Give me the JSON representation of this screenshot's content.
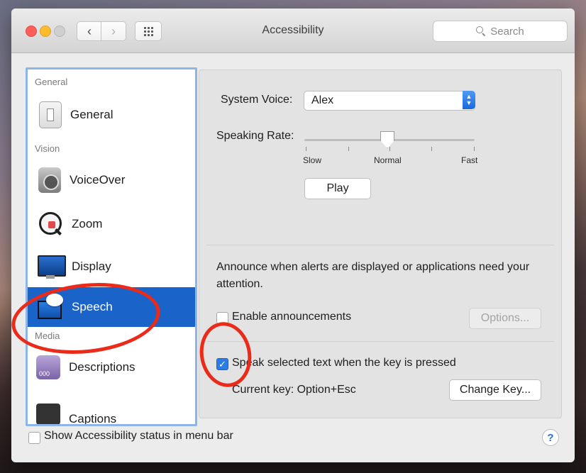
{
  "window": {
    "title": "Accessibility",
    "search_placeholder": "Search"
  },
  "nav": {
    "back_glyph": "‹",
    "forward_glyph": "›"
  },
  "sidebar": {
    "categories": {
      "general": "General",
      "vision": "Vision",
      "media": "Media"
    },
    "items": [
      {
        "label": "General",
        "icon": "general-switch-icon"
      },
      {
        "label": "VoiceOver",
        "icon": "voiceover-icon"
      },
      {
        "label": "Zoom",
        "icon": "zoom-magnifier-icon"
      },
      {
        "label": "Display",
        "icon": "display-monitor-icon"
      },
      {
        "label": "Speech",
        "icon": "speech-bubble-icon",
        "selected": true
      },
      {
        "label": "Descriptions",
        "icon": "descriptions-icon"
      },
      {
        "label": "Captions",
        "icon": "captions-icon"
      }
    ]
  },
  "speech": {
    "system_voice_label": "System Voice:",
    "system_voice_value": "Alex",
    "speaking_rate_label": "Speaking Rate:",
    "rate_slow": "Slow",
    "rate_normal": "Normal",
    "rate_fast": "Fast",
    "rate_level": 0.5,
    "play_button": "Play",
    "announce_text": "Announce when alerts are displayed or applications need your attention.",
    "enable_announcements": "Enable announcements",
    "enable_announcements_checked": false,
    "options_button": "Options...",
    "speak_selected": "Speak selected text when the key is pressed",
    "speak_selected_checked": true,
    "current_key": "Current key: Option+Esc",
    "change_key_button": "Change Key..."
  },
  "footer": {
    "show_status": "Show Accessibility status in menu bar",
    "show_status_checked": false,
    "help_glyph": "?"
  },
  "colors": {
    "selection": "#1a63c8",
    "annotation_red": "#ea2b1a",
    "accent": "#2b7de6"
  }
}
